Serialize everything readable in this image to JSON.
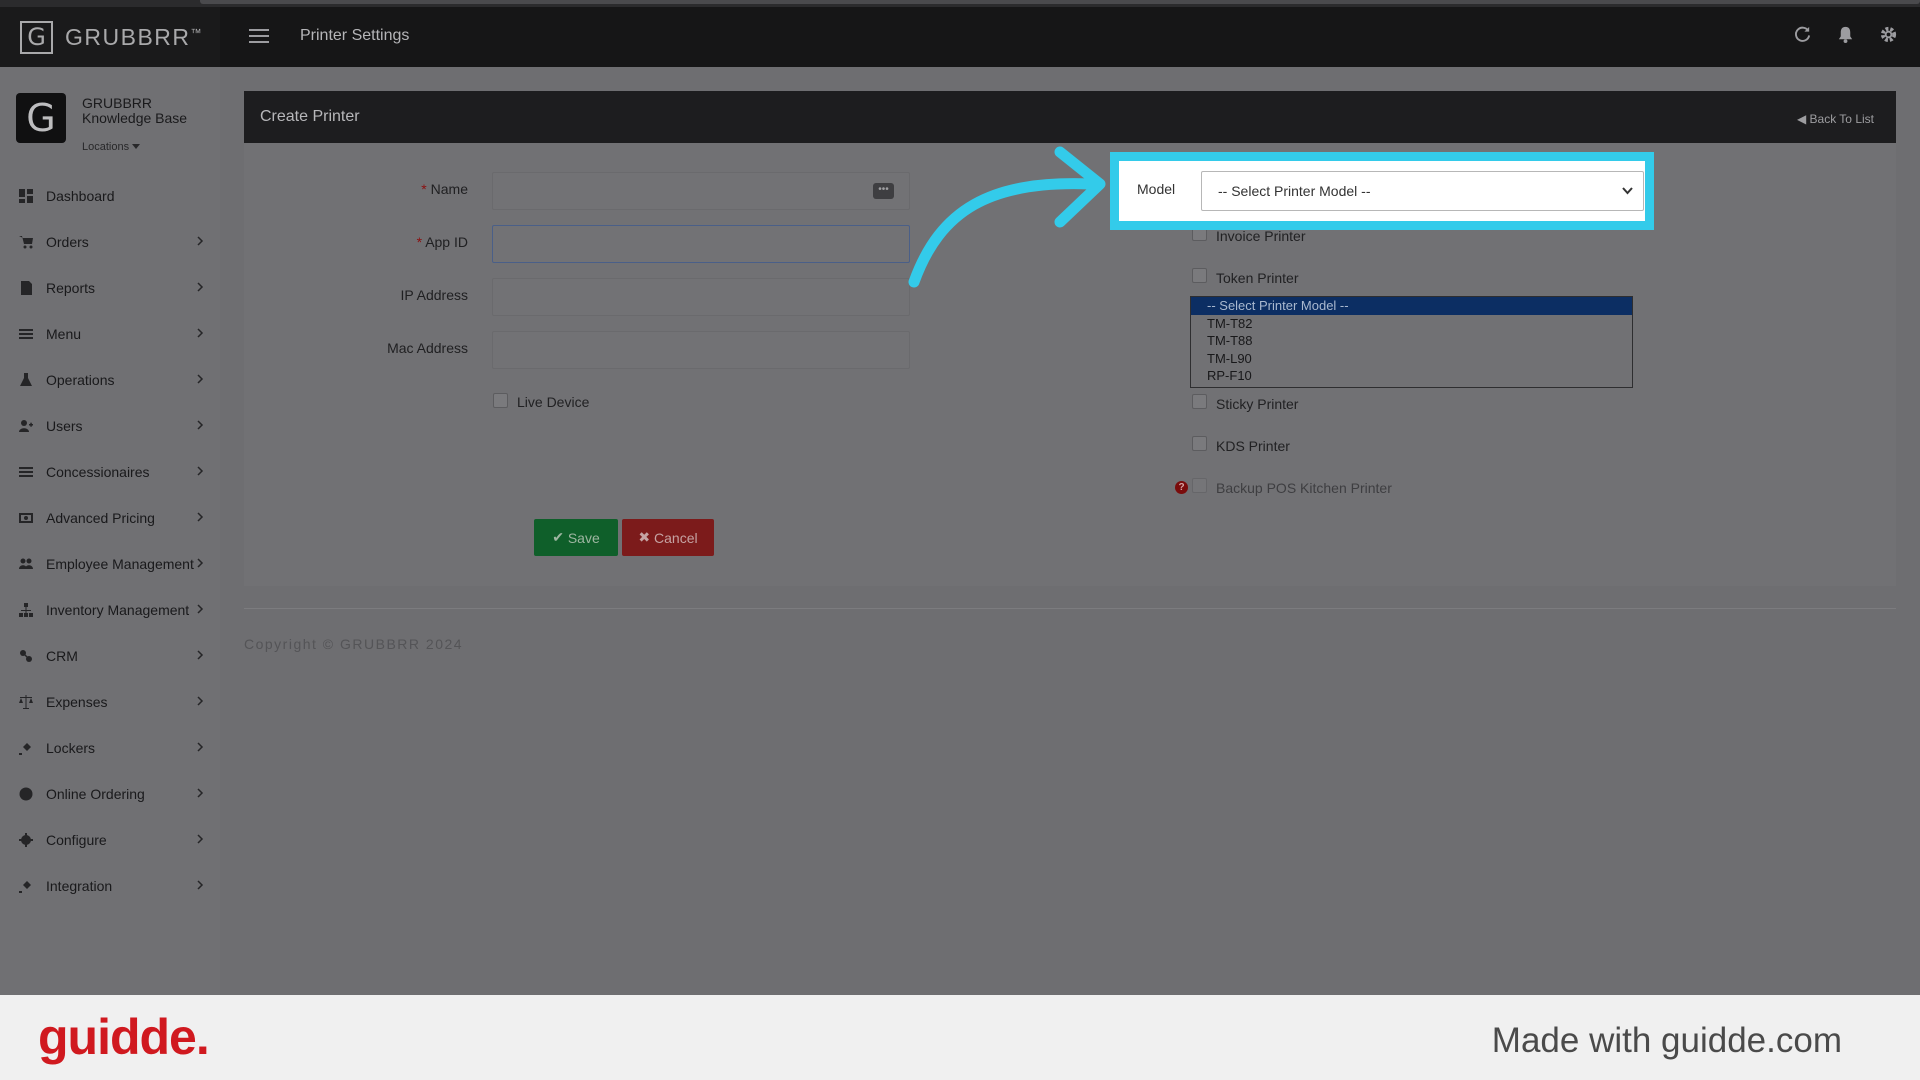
{
  "header": {
    "brand_letter": "G",
    "brand_name": "GRUBBRR",
    "brand_tm": "™",
    "page_title": "Printer Settings"
  },
  "sidebar": {
    "avatar_letter": "G",
    "profile_name": "GRUBBRR Knowledge Base",
    "locations_label": "Locations",
    "items": [
      {
        "label": "Dashboard",
        "icon": "dashboard-icon",
        "has_chevron": false
      },
      {
        "label": "Orders",
        "icon": "cart-icon",
        "has_chevron": true
      },
      {
        "label": "Reports",
        "icon": "report-icon",
        "has_chevron": true
      },
      {
        "label": "Menu",
        "icon": "menu-icon",
        "has_chevron": true
      },
      {
        "label": "Operations",
        "icon": "flask-icon",
        "has_chevron": true
      },
      {
        "label": "Users",
        "icon": "user-plus-icon",
        "has_chevron": true
      },
      {
        "label": "Concessionaires",
        "icon": "list-icon",
        "has_chevron": true
      },
      {
        "label": "Advanced Pricing",
        "icon": "money-icon",
        "has_chevron": true
      },
      {
        "label": "Employee Management",
        "icon": "users-icon",
        "has_chevron": true
      },
      {
        "label": "Inventory Management",
        "icon": "sitemap-icon",
        "has_chevron": true
      },
      {
        "label": "CRM",
        "icon": "link-icon",
        "has_chevron": true
      },
      {
        "label": "Expenses",
        "icon": "scale-icon",
        "has_chevron": true
      },
      {
        "label": "Lockers",
        "icon": "plug-icon",
        "has_chevron": true
      },
      {
        "label": "Online Ordering",
        "icon": "globe-icon",
        "has_chevron": true
      },
      {
        "label": "Configure",
        "icon": "gear-icon",
        "has_chevron": true
      },
      {
        "label": "Integration",
        "icon": "plug-icon",
        "has_chevron": true
      }
    ]
  },
  "card": {
    "title": "Create Printer",
    "back_link": "Back To List"
  },
  "form": {
    "required_mark": "*",
    "name_label": "Name",
    "name_value": "",
    "app_id_label": "App ID",
    "app_id_value": "",
    "ip_label": "IP Address",
    "ip_value": "",
    "mac_label": "Mac Address",
    "mac_value": "",
    "live_device_label": "Live Device",
    "dots": "•••",
    "save_label": "Save",
    "cancel_label": "Cancel"
  },
  "printers": {
    "model_label": "Model",
    "model_selected": "-- Select Printer Model --",
    "model_options": [
      "-- Select Printer Model --",
      "TM-T82",
      "TM-T88",
      "TM-L90",
      "RP-F10"
    ],
    "invoice_label": "Invoice Printer",
    "token_label": "Token Printer",
    "sticky_label": "Sticky Printer",
    "kds_label": "KDS Printer",
    "backup_label": "Backup POS Kitchen Printer",
    "help_glyph": "?"
  },
  "footer": {
    "copyright": "Copyright © GRUBBRR 2024",
    "guidde_logo": "guidde.",
    "made_with": "Made with guidde.com"
  },
  "colors": {
    "highlight": "#33cbea",
    "save": "#0f5f2a",
    "cancel": "#7c1b1b",
    "guidde_red": "#d0191f"
  }
}
